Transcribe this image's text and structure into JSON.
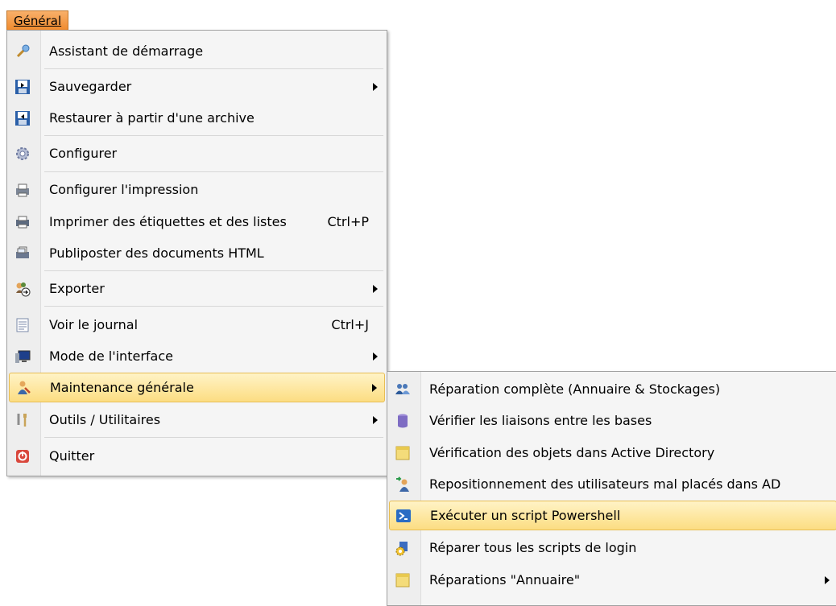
{
  "menubar": {
    "title": "Général"
  },
  "menu": {
    "items": [
      {
        "label": "Assistant de démarrage",
        "icon": "wand-icon"
      },
      {
        "label": "Sauvegarder",
        "icon": "save-icon",
        "submenu": true
      },
      {
        "label": "Restaurer à partir d'une archive",
        "icon": "restore-icon"
      },
      {
        "label": "Configurer",
        "icon": "gear-icon"
      },
      {
        "label": "Configurer l'impression",
        "icon": "print-setup-icon"
      },
      {
        "label": "Imprimer des étiquettes et des listes",
        "icon": "printer-icon",
        "shortcut": "Ctrl+P"
      },
      {
        "label": "Publiposter des documents HTML",
        "icon": "mailmerge-icon"
      },
      {
        "label": "Exporter",
        "icon": "export-users-icon",
        "submenu": true
      },
      {
        "label": "Voir le journal",
        "icon": "log-icon",
        "shortcut": "Ctrl+J"
      },
      {
        "label": "Mode de l'interface",
        "icon": "monitor-icon",
        "submenu": true
      },
      {
        "label": "Maintenance générale",
        "icon": "maintenance-user-icon",
        "submenu": true,
        "highlighted": true
      },
      {
        "label": "Outils / Utilitaires",
        "icon": "tools-icon",
        "submenu": true
      },
      {
        "label": "Quitter",
        "icon": "power-icon"
      }
    ]
  },
  "submenu": {
    "items": [
      {
        "label": "Réparation complète (Annuaire & Stockages)",
        "icon": "users-repair-icon"
      },
      {
        "label": "Vérifier les liaisons entre les bases",
        "icon": "database-icon"
      },
      {
        "label": "Vérification des objets dans Active Directory",
        "icon": "folder-icon"
      },
      {
        "label": "Repositionnement des utilisateurs mal placés dans AD",
        "icon": "user-move-icon"
      },
      {
        "label": "Exécuter un script Powershell",
        "icon": "powershell-icon",
        "highlighted": true
      },
      {
        "label": "Réparer tous les scripts de login",
        "icon": "script-gear-icon"
      },
      {
        "label": "Réparations \"Annuaire\"",
        "icon": "folder-icon",
        "submenu": true
      }
    ]
  },
  "colors": {
    "accent": "#f08a2c",
    "highlight": "#fcdd82"
  }
}
